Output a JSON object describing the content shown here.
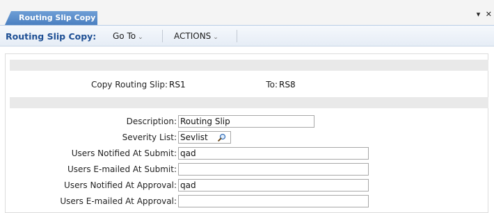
{
  "tab": {
    "title": "Routing Slip Copy",
    "controls": {
      "menu": "▾",
      "close": "✕"
    }
  },
  "toolbar": {
    "title": "Routing Slip Copy:",
    "goto_label": "Go To",
    "actions_label": "ACTIONS",
    "chevron": "⌄"
  },
  "copy": {
    "from_label": "Copy Routing Slip:",
    "from_value": "RS1",
    "to_label": "To:",
    "to_value": "RS8"
  },
  "form": {
    "description": {
      "label": "Description:",
      "value": "Routing Slip"
    },
    "severity_list": {
      "label": "Severity List:",
      "value": "Sevlist"
    },
    "users_notified_submit": {
      "label": "Users Notified At Submit:",
      "value": "qad"
    },
    "users_emailed_submit": {
      "label": "Users E-mailed At Submit:",
      "value": ""
    },
    "users_notified_approval": {
      "label": "Users Notified At Approval:",
      "value": "qad"
    },
    "users_emailed_approval": {
      "label": "Users E-mailed At Approval:",
      "value": ""
    }
  },
  "colors": {
    "accent": "#1e4f94",
    "tab": "#5a8cca",
    "band": "#e9e9e9"
  }
}
